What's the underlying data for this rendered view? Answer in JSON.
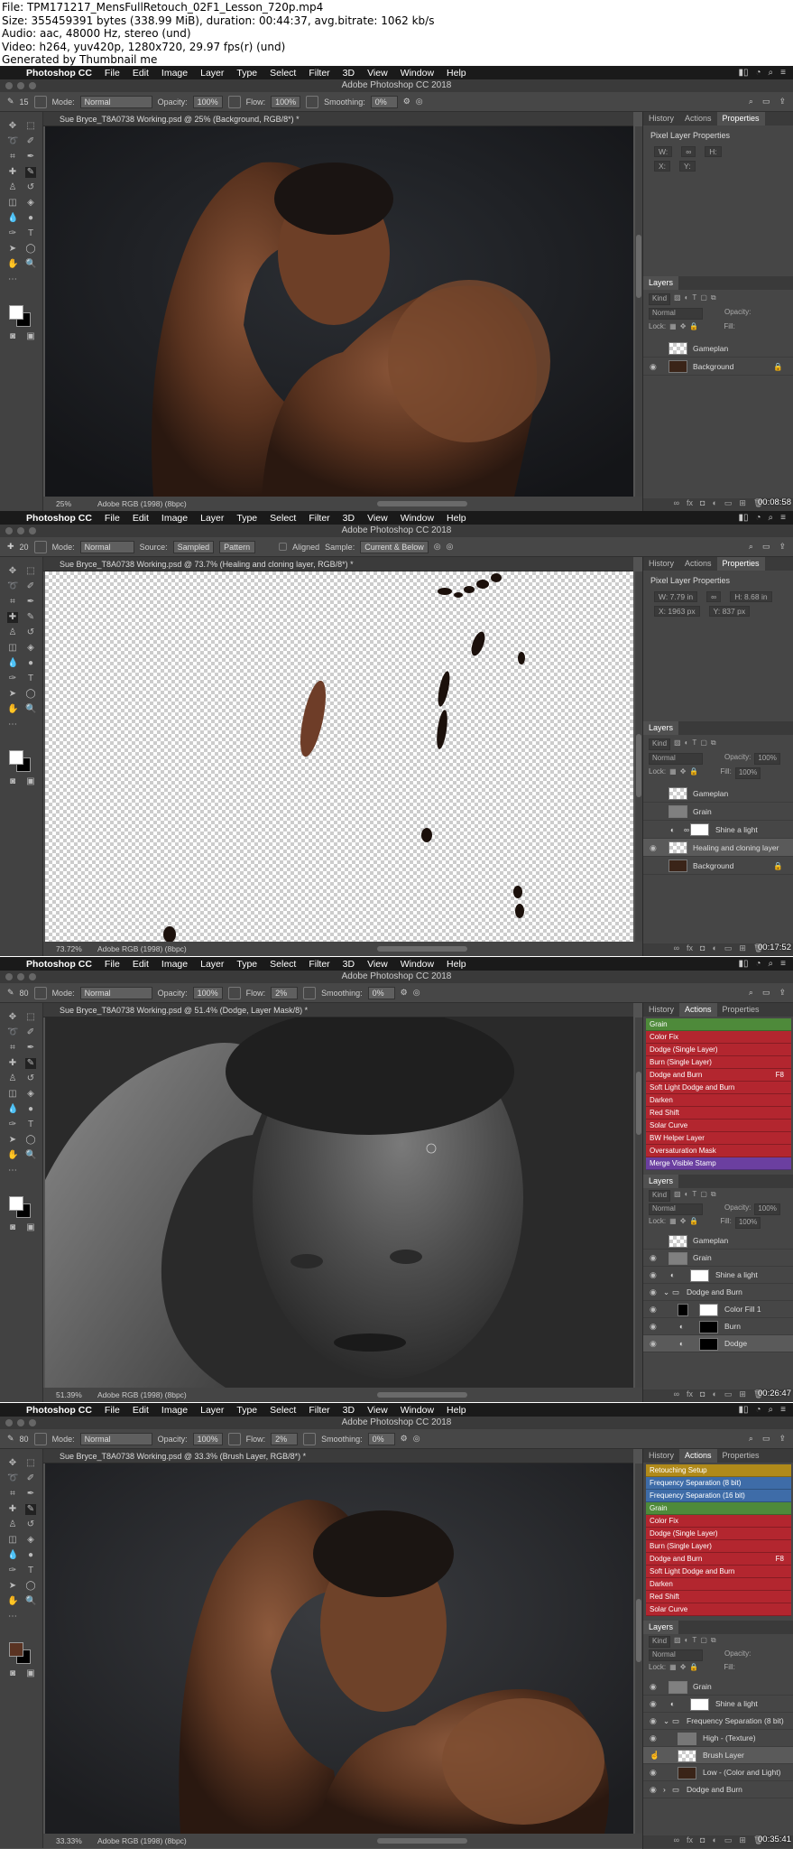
{
  "meta": {
    "file": "File: TPM171217_MensFullRetouch_02F1_Lesson_720p.mp4",
    "size": "Size: 355459391 bytes (338.99 MiB), duration: 00:44:37, avg.bitrate: 1062 kb/s",
    "audio": "Audio: aac, 48000 Hz, stereo (und)",
    "video": "Video: h264, yuv420p, 1280x720, 29.97 fps(r) (und)",
    "generated": "Generated by Thumbnail me"
  },
  "app": {
    "apple": "",
    "menu": [
      "Photoshop CC",
      "File",
      "Edit",
      "Image",
      "Layer",
      "Type",
      "Select",
      "Filter",
      "3D",
      "View",
      "Window",
      "Help"
    ],
    "window_title": "Adobe Photoshop CC 2018"
  },
  "colors": {
    "action_green": "#4e8a3a",
    "action_red": "#b3262f",
    "action_purple": "#6b3fa0",
    "action_gold": "#b08a1a",
    "action_blue": "#3e6ca8"
  },
  "frames": [
    {
      "timestamp": "00:08:58",
      "options": {
        "mode_label": "Mode:",
        "mode": "Normal",
        "opacity_label": "Opacity:",
        "opacity": "100%",
        "flow_label": "Flow:",
        "flow": "100%",
        "smoothing_label": "Smoothing:",
        "smoothing": "0%",
        "brush_size": "15"
      },
      "doc_tab": "Sue Bryce_T8A0738 Working.psd @ 25% (Background, RGB/8*) *",
      "status": {
        "zoom": "25%",
        "profile": "Adobe RGB (1998) (8bpc)"
      },
      "panel_tabs": [
        "History",
        "Actions",
        "Properties"
      ],
      "panel_active": "Properties",
      "props_title": "Pixel Layer Properties",
      "props": {
        "w": "W:",
        "h": "H:",
        "x": "X:",
        "y": "Y:"
      },
      "layers_title": "Layers",
      "layers_kind": "Kind",
      "blend": "Normal",
      "opacity_label": "Opacity:",
      "lock_label": "Lock:",
      "fill_label": "Fill:",
      "layers": [
        "Gameplan",
        "Background"
      ]
    },
    {
      "timestamp": "00:17:52",
      "options": {
        "mode_label": "Mode:",
        "mode": "Normal",
        "source_label": "Source:",
        "sampled": "Sampled",
        "pattern": "Pattern",
        "aligned": "Aligned",
        "sample_label": "Sample:",
        "sample": "Current & Below",
        "brush_size": "20"
      },
      "doc_tab": "Sue Bryce_T8A0738 Working.psd @ 73.7% (Healing and cloning layer, RGB/8*) *",
      "status": {
        "zoom": "73.72%",
        "profile": "Adobe RGB (1998) (8bpc)"
      },
      "panel_tabs": [
        "History",
        "Actions",
        "Properties"
      ],
      "panel_active": "Properties",
      "props_title": "Pixel Layer Properties",
      "props": {
        "w": "W: 7.79 in",
        "h": "H: 8.68 in",
        "x": "X: 1963 px",
        "y": "Y: 837 px"
      },
      "layers_title": "Layers",
      "layers_kind": "Kind",
      "blend": "Normal",
      "opacity_label": "Opacity:",
      "opacity": "100%",
      "lock_label": "Lock:",
      "fill_label": "Fill:",
      "fill": "100%",
      "layers": [
        "Gameplan",
        "Grain",
        "Shine a light",
        "Healing and cloning layer",
        "Background"
      ]
    },
    {
      "timestamp": "00:26:47",
      "options": {
        "mode_label": "Mode:",
        "mode": "Normal",
        "opacity_label": "Opacity:",
        "opacity": "100%",
        "flow_label": "Flow:",
        "flow": "2%",
        "smoothing_label": "Smoothing:",
        "smoothing": "0%",
        "brush_size": "80"
      },
      "doc_tab": "Sue Bryce_T8A0738 Working.psd @ 51.4% (Dodge, Layer Mask/8) *",
      "status": {
        "zoom": "51.39%",
        "profile": "Adobe RGB (1998) (8bpc)"
      },
      "panel_tabs": [
        "History",
        "Actions",
        "Properties"
      ],
      "panel_active": "Actions",
      "actions": [
        {
          "label": "Grain",
          "color": "green"
        },
        {
          "label": "Color Fix",
          "color": "red"
        },
        {
          "label": "Dodge (Single Layer)",
          "color": "red"
        },
        {
          "label": "Burn (Single Layer)",
          "color": "red"
        },
        {
          "label": "Dodge and Burn",
          "color": "red",
          "fkey": "F8"
        },
        {
          "label": "Soft Light Dodge and Burn",
          "color": "red"
        },
        {
          "label": "Darken",
          "color": "red"
        },
        {
          "label": "Red Shift",
          "color": "red"
        },
        {
          "label": "Solar Curve",
          "color": "red"
        },
        {
          "label": "BW Helper Layer",
          "color": "red"
        },
        {
          "label": "Oversaturation Mask",
          "color": "red"
        },
        {
          "label": "Merge Visible Stamp",
          "color": "purple"
        }
      ],
      "layers_title": "Layers",
      "layers_kind": "Kind",
      "blend": "Normal",
      "opacity_label": "Opacity:",
      "opacity": "100%",
      "lock_label": "Lock:",
      "fill_label": "Fill:",
      "fill": "100%",
      "layers": [
        "Gameplan",
        "Grain",
        "Shine a light",
        "Dodge and Burn",
        "Color Fill 1",
        "Burn",
        "Dodge"
      ]
    },
    {
      "timestamp": "00:35:41",
      "options": {
        "mode_label": "Mode:",
        "mode": "Normal",
        "opacity_label": "Opacity:",
        "opacity": "100%",
        "flow_label": "Flow:",
        "flow": "2%",
        "smoothing_label": "Smoothing:",
        "smoothing": "0%",
        "brush_size": "80"
      },
      "doc_tab": "Sue Bryce_T8A0738 Working.psd @ 33.3% (Brush Layer, RGB/8*) *",
      "status": {
        "zoom": "33.33%",
        "profile": "Adobe RGB (1998) (8bpc)"
      },
      "panel_tabs": [
        "History",
        "Actions",
        "Properties"
      ],
      "panel_active": "Actions",
      "actions": [
        {
          "label": "Retouching Setup",
          "color": "gold"
        },
        {
          "label": "Frequency Separation (8 bit)",
          "color": "blue"
        },
        {
          "label": "Frequency Separation (16 bit)",
          "color": "blue"
        },
        {
          "label": "Grain",
          "color": "green"
        },
        {
          "label": "Color Fix",
          "color": "red"
        },
        {
          "label": "Dodge (Single Layer)",
          "color": "red"
        },
        {
          "label": "Burn (Single Layer)",
          "color": "red"
        },
        {
          "label": "Dodge and Burn",
          "color": "red",
          "fkey": "F8"
        },
        {
          "label": "Soft Light Dodge and Burn",
          "color": "red"
        },
        {
          "label": "Darken",
          "color": "red"
        },
        {
          "label": "Red Shift",
          "color": "red"
        },
        {
          "label": "Solar Curve",
          "color": "red"
        }
      ],
      "layers_title": "Layers",
      "layers_kind": "Kind",
      "blend": "Normal",
      "opacity_label": "Opacity:",
      "lock_label": "Lock:",
      "fill_label": "Fill:",
      "layers": [
        "Grain",
        "Shine a light",
        "Frequency Separation (8 bit)",
        "High - (Texture)",
        "Brush Layer",
        "Low - (Color and Light)",
        "Dodge and Burn"
      ]
    }
  ]
}
